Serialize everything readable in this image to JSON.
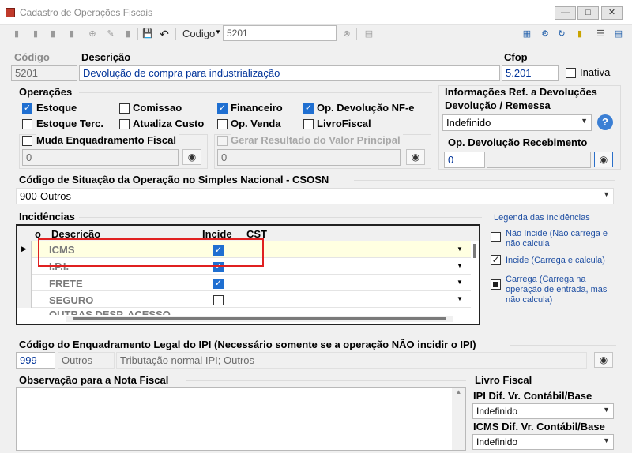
{
  "window": {
    "title": "Cadastro de Operações Fiscais"
  },
  "toolbar": {
    "codigo_label": "Codigo",
    "codigo_value": "5201"
  },
  "header": {
    "codigo_label": "Código",
    "codigo_value": "5201",
    "descricao_label": "Descrição",
    "descricao_value": "Devolução de compra para industrialização",
    "cfop_label": "Cfop",
    "cfop_value": "5.201",
    "inativa_label": "Inativa"
  },
  "operacoes": {
    "title": "Operações",
    "estoque": "Estoque",
    "comissao": "Comissao",
    "financeiro": "Financeiro",
    "op_devolucao_nfe": "Op.  Devolução NF-e",
    "estoque_terc": "Estoque Terc.",
    "atualiza_custo": "Atualiza Custo",
    "op_venda": "Op. Venda",
    "livro_fiscal": "LivroFiscal",
    "muda_enquadramento": "Muda Enquadramento Fiscal",
    "muda_value": "0",
    "gerar_resultado": "Gerar Resultado do Valor Principal",
    "gerar_value": "0"
  },
  "info_devolucao": {
    "title1": "Informações Ref. a Devoluções",
    "title2": "Devolução / Remessa",
    "select_value": "Indefinido",
    "op_recebimento_label": "Op. Devolução Recebimento",
    "op_recebimento_value": "0"
  },
  "csosn": {
    "label": "Código de Situação da Operação no Simples Nacional - CSOSN",
    "value": "900-Outros"
  },
  "incidencias": {
    "title": "Incidências",
    "columns": [
      "o",
      "Descrição",
      "Incide",
      "CST"
    ],
    "rows": [
      {
        "descricao": "ICMS",
        "incide": true
      },
      {
        "descricao": "I.P.I.",
        "incide": true
      },
      {
        "descricao": "FRETE",
        "incide": true
      },
      {
        "descricao": "SEGURO",
        "incide": false
      },
      {
        "descricao": "OUTRAS DESP. ACESSO",
        "incide": false
      }
    ]
  },
  "legenda": {
    "title": "Legenda das Incidências",
    "nao_incide": "Não Incide (Não carrega e não calcula",
    "incide": "Incide (Carrega e calcula)",
    "carrega": "Carrega (Carrega na operação de entrada, mas não calcula)"
  },
  "enquadramento_ipi": {
    "label": "Código do Enquadramento Legal do IPI (Necessário somente se a operação NÃO incidir o IPI)",
    "code": "999",
    "group": "Outros",
    "description": "Tributação normal IPI; Outros"
  },
  "observacao": {
    "label": "Observação para a Nota Fiscal",
    "value": ""
  },
  "livro_fiscal": {
    "title": "Livro Fiscal",
    "ipi_label": "IPI Dif. Vr. Contábil/Base",
    "ipi_value": "Indefinido",
    "icms_label": "ICMS Dif. Vr. Contábil/Base",
    "icms_value": "Indefinido"
  },
  "colors": {
    "highlight_box": "#e02020",
    "accent": "#1f6fd1",
    "selected_row": "#ffffe1"
  }
}
